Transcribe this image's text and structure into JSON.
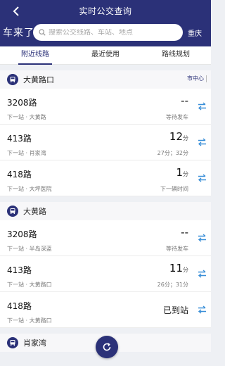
{
  "header": {
    "title": "实时公交查询",
    "brand": "车来了",
    "city": "重庆",
    "search_placeholder": "搜索公交线路、车站、地点"
  },
  "tabs": [
    {
      "label": "附近线路",
      "active": true
    },
    {
      "label": "最近使用",
      "active": false
    },
    {
      "label": "路线规划",
      "active": false
    }
  ],
  "colors": {
    "primary": "#2b3178",
    "swap_icon": "#3a8fd8"
  },
  "stops": [
    {
      "name": "大黄路口",
      "tag": "市中心",
      "routes": [
        {
          "route": "3208路",
          "next": "下一站 · 大黄路",
          "eta": "--",
          "unit": "",
          "sub": "等待发车"
        },
        {
          "route": "413路",
          "next": "下一站 · 肖家湾",
          "eta": "12",
          "unit": "分",
          "sub": "27分；32分"
        },
        {
          "route": "418路",
          "next": "下一站 · 大坪医院",
          "eta": "1",
          "unit": "分",
          "sub": "下一辆时间"
        }
      ]
    },
    {
      "name": "大黄路",
      "tag": "",
      "routes": [
        {
          "route": "3208路",
          "next": "下一站 · 半岛深蓝",
          "eta": "--",
          "unit": "",
          "sub": "等待发车"
        },
        {
          "route": "413路",
          "next": "下一站 · 大黄路口",
          "eta": "11",
          "unit": "分",
          "sub": "26分；31分"
        },
        {
          "route": "418路",
          "next": "下一站 · 大黄路口",
          "eta": "已到站",
          "unit": "",
          "sub": ""
        }
      ]
    },
    {
      "name": "肖家湾",
      "tag": "",
      "routes": []
    }
  ],
  "icons": {
    "back": "chevron-left-icon",
    "search": "search-icon",
    "stop": "bus-icon",
    "swap": "swap-arrows-icon",
    "refresh": "refresh-icon"
  }
}
